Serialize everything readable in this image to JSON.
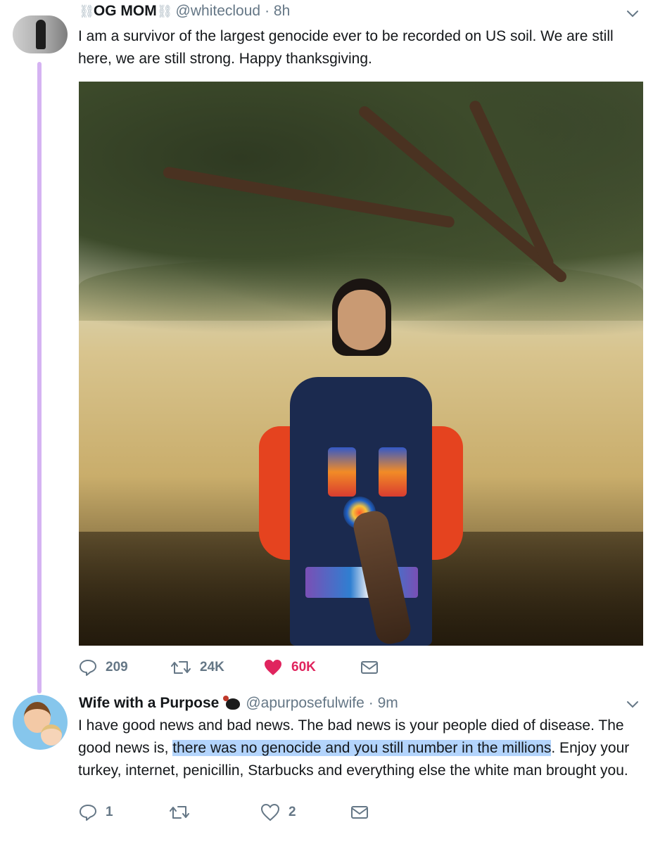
{
  "tweets": [
    {
      "display_name": "OG MOM",
      "name_emoji_glyph": "⛓",
      "handle": "@whitecloud",
      "time": "· 8h",
      "text": "I am a survivor of the largest genocide ever to be recorded on US soil. We are still here, we are still strong. Happy thanksgiving.",
      "has_photo": true,
      "replies": "209",
      "retweets": "24K",
      "likes": "60K",
      "liked": true
    },
    {
      "display_name": "Wife with a Purpose",
      "handle": "@apurposefulwife",
      "time": "· 9m",
      "text_before": "I have good news and bad news. The bad news is your people died of disease. The good news is, ",
      "text_highlight": "there was no genocide and you still number in the millions",
      "text_after": ". Enjoy your turkey, internet, penicillin, Starbucks and everything else the white man brought you.",
      "replies": "1",
      "retweets": "",
      "likes": "2",
      "liked": false
    }
  ],
  "icons": {
    "caret": "chevron-down-icon",
    "reply": "reply-icon",
    "retweet": "retweet-icon",
    "like": "heart-icon",
    "message": "envelope-icon",
    "turkey": "turkey-emoji-icon"
  },
  "colors": {
    "thread_line": "#d5b3f2",
    "muted": "#657786",
    "like_red": "#e0245e",
    "highlight": "#b3d4fc"
  }
}
